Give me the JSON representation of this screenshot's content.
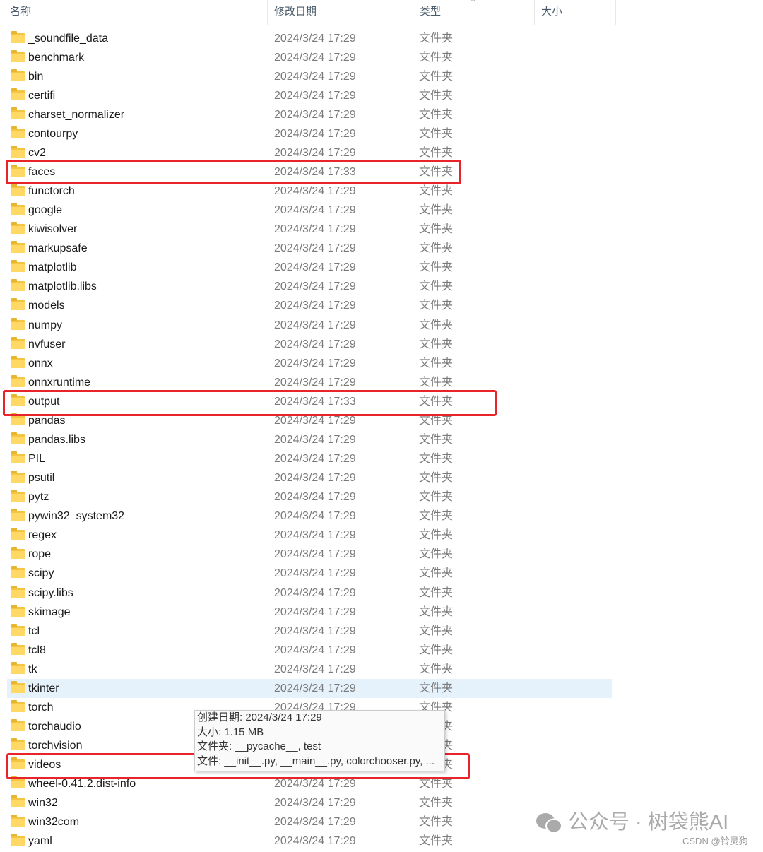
{
  "header": {
    "columns": [
      "名称",
      "修改日期",
      "类型",
      "大小"
    ],
    "sort_icon": "chevron-up-icon"
  },
  "files": [
    {
      "name": "_soundfile_data",
      "date": "2024/3/24 17:29",
      "type": "文件夹"
    },
    {
      "name": "benchmark",
      "date": "2024/3/24 17:29",
      "type": "文件夹"
    },
    {
      "name": "bin",
      "date": "2024/3/24 17:29",
      "type": "文件夹"
    },
    {
      "name": "certifi",
      "date": "2024/3/24 17:29",
      "type": "文件夹"
    },
    {
      "name": "charset_normalizer",
      "date": "2024/3/24 17:29",
      "type": "文件夹"
    },
    {
      "name": "contourpy",
      "date": "2024/3/24 17:29",
      "type": "文件夹"
    },
    {
      "name": "cv2",
      "date": "2024/3/24 17:29",
      "type": "文件夹"
    },
    {
      "name": "faces",
      "date": "2024/3/24 17:33",
      "type": "文件夹",
      "highlighted": true
    },
    {
      "name": "functorch",
      "date": "2024/3/24 17:29",
      "type": "文件夹"
    },
    {
      "name": "google",
      "date": "2024/3/24 17:29",
      "type": "文件夹"
    },
    {
      "name": "kiwisolver",
      "date": "2024/3/24 17:29",
      "type": "文件夹"
    },
    {
      "name": "markupsafe",
      "date": "2024/3/24 17:29",
      "type": "文件夹"
    },
    {
      "name": "matplotlib",
      "date": "2024/3/24 17:29",
      "type": "文件夹"
    },
    {
      "name": "matplotlib.libs",
      "date": "2024/3/24 17:29",
      "type": "文件夹"
    },
    {
      "name": "models",
      "date": "2024/3/24 17:29",
      "type": "文件夹"
    },
    {
      "name": "numpy",
      "date": "2024/3/24 17:29",
      "type": "文件夹"
    },
    {
      "name": "nvfuser",
      "date": "2024/3/24 17:29",
      "type": "文件夹"
    },
    {
      "name": "onnx",
      "date": "2024/3/24 17:29",
      "type": "文件夹"
    },
    {
      "name": "onnxruntime",
      "date": "2024/3/24 17:29",
      "type": "文件夹"
    },
    {
      "name": "output",
      "date": "2024/3/24 17:33",
      "type": "文件夹",
      "highlighted": true
    },
    {
      "name": "pandas",
      "date": "2024/3/24 17:29",
      "type": "文件夹"
    },
    {
      "name": "pandas.libs",
      "date": "2024/3/24 17:29",
      "type": "文件夹"
    },
    {
      "name": "PIL",
      "date": "2024/3/24 17:29",
      "type": "文件夹"
    },
    {
      "name": "psutil",
      "date": "2024/3/24 17:29",
      "type": "文件夹"
    },
    {
      "name": "pytz",
      "date": "2024/3/24 17:29",
      "type": "文件夹"
    },
    {
      "name": "pywin32_system32",
      "date": "2024/3/24 17:29",
      "type": "文件夹"
    },
    {
      "name": "regex",
      "date": "2024/3/24 17:29",
      "type": "文件夹"
    },
    {
      "name": "rope",
      "date": "2024/3/24 17:29",
      "type": "文件夹"
    },
    {
      "name": "scipy",
      "date": "2024/3/24 17:29",
      "type": "文件夹"
    },
    {
      "name": "scipy.libs",
      "date": "2024/3/24 17:29",
      "type": "文件夹"
    },
    {
      "name": "skimage",
      "date": "2024/3/24 17:29",
      "type": "文件夹"
    },
    {
      "name": "tcl",
      "date": "2024/3/24 17:29",
      "type": "文件夹"
    },
    {
      "name": "tcl8",
      "date": "2024/3/24 17:29",
      "type": "文件夹"
    },
    {
      "name": "tk",
      "date": "2024/3/24 17:29",
      "type": "文件夹"
    },
    {
      "name": "tkinter",
      "date": "2024/3/24 17:29",
      "type": "文件夹",
      "hovered": true
    },
    {
      "name": "torch",
      "date": "2024/3/24 17:29",
      "type": "文件夹"
    },
    {
      "name": "torchaudio",
      "date": "",
      "type": "文件夹"
    },
    {
      "name": "torchvision",
      "date": "",
      "type": "文件夹"
    },
    {
      "name": "videos",
      "date": "",
      "type": "文件夹",
      "highlighted": true
    },
    {
      "name": "wheel-0.41.2.dist-info",
      "date": "2024/3/24 17:29",
      "type": "文件夹"
    },
    {
      "name": "win32",
      "date": "2024/3/24 17:29",
      "type": "文件夹"
    },
    {
      "name": "win32com",
      "date": "2024/3/24 17:29",
      "type": "文件夹"
    },
    {
      "name": "yaml",
      "date": "2024/3/24 17:29",
      "type": "文件夹"
    }
  ],
  "tooltip": {
    "created": "创建日期: 2024/3/24 17:29",
    "size": "大小: 1.15 MB",
    "folders": "文件夹: __pycache__, test",
    "files": "文件: __init__.py, __main__.py, colorchooser.py, ..."
  },
  "watermark": {
    "text": "公众号 · 树袋熊AI",
    "csdn": "CSDN @铃灵狗"
  },
  "colors": {
    "highlight_box": "#e8242a",
    "hover_row": "#e5f1fb",
    "folder": "#ffd866"
  }
}
